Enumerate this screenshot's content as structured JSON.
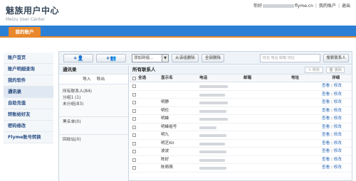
{
  "header": {
    "brand_cn": "魅族用户中心",
    "brand_en": "Meizu User Center",
    "user_prefix": "你好",
    "user_suffix": "flyme.cn",
    "my_account": "我的账户",
    "logout": "退出"
  },
  "tabs": {
    "active": "我的账户"
  },
  "sidebar": {
    "items": [
      {
        "label": "账户首页"
      },
      {
        "label": "账户明细查询"
      },
      {
        "label": "我的软件"
      },
      {
        "label": "通讯录"
      },
      {
        "label": "自助充值"
      },
      {
        "label": "转账给好友"
      },
      {
        "label": "密码修改"
      },
      {
        "label": "Flyme账号转换"
      }
    ]
  },
  "toolbar": {
    "add_contact_icon": "+👤",
    "add_group_icon": "+👥",
    "select_value": "添加到组...",
    "remove_from_group": "从该组删除",
    "delete_all": "全部删除",
    "search_placeholder": "姓名 电话 邮箱 地址",
    "search_button": "搜索联系人"
  },
  "groups": {
    "title": "通讯录",
    "import": "导入",
    "export": "导出",
    "all": "所有联系人(84)",
    "group1": "分组1 (1)",
    "ungrouped": "未分组(83)",
    "blacklist": "黑名单(0)",
    "recycle": "回收站(0)"
  },
  "contacts": {
    "title": "所有联系人",
    "edit": "修改",
    "delete": "删除",
    "columns": {
      "select_all": "全选",
      "name": "显示名",
      "phone": "电话",
      "email": "邮箱",
      "address": "地址",
      "details": "详细"
    },
    "view": "查看",
    "modify": "修改",
    "rows": [
      {
        "name": ""
      },
      {
        "name": ""
      },
      {
        "name": "明静"
      },
      {
        "name": "明伦"
      },
      {
        "name": "明蜂"
      },
      {
        "name": "明蜂姐号"
      },
      {
        "name": "明九"
      },
      {
        "name": "明芝Kit"
      },
      {
        "name": "波波"
      },
      {
        "name": "陈好"
      },
      {
        "name": "陈萌萌"
      }
    ]
  }
}
